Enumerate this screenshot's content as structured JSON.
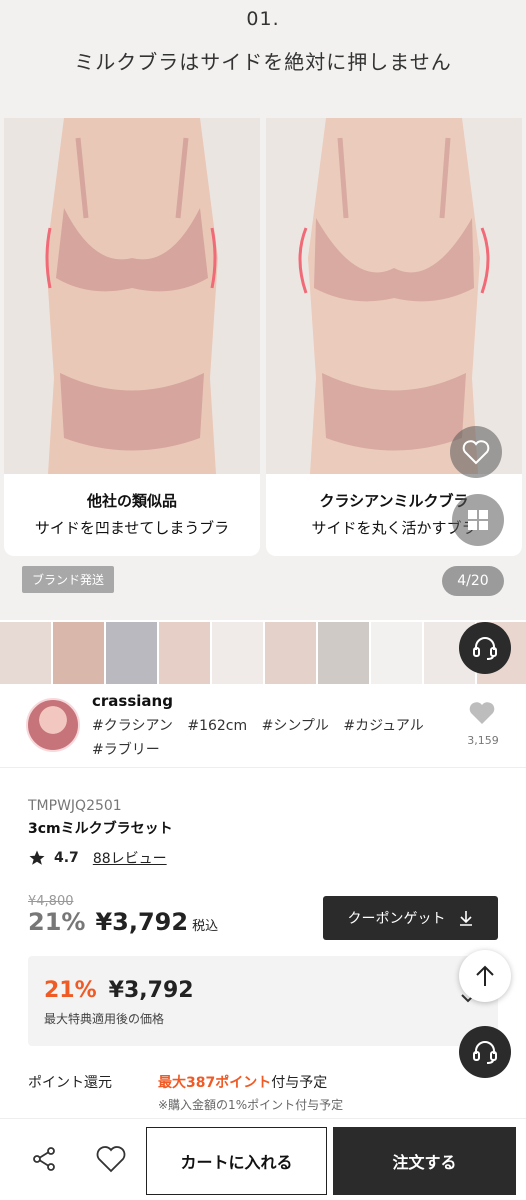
{
  "hero": {
    "number": "01.",
    "title": "ミルクブラはサイドを絶対に押しません",
    "left_caption": {
      "line1": "他社の類似品",
      "line2": "サイドを凹ませてしまうブラ"
    },
    "right_caption": {
      "line1": "クラシアンミルクブラ",
      "line2": "サイドを丸く活かすブラ"
    },
    "brand_badge": "ブランド発送",
    "counter": "4/20"
  },
  "seller": {
    "name": "crassiang",
    "tags": [
      "#クラシアン",
      "#162cm",
      "#シンプル",
      "#カジュアル",
      "#ラブリー"
    ],
    "like_count": "3,159"
  },
  "product": {
    "code": "TMPWJQ2501",
    "name": "3cmミルクブラセット",
    "rating": "4.7",
    "reviews": "88レビュー",
    "original_price": "¥4,800",
    "discount": "21%",
    "price": "¥3,792",
    "tax_label": "税込",
    "coupon_button": "クーポンゲット",
    "best_discount": "21%",
    "best_price": "¥3,792",
    "best_note": "最大特典適用後の価格",
    "points_label": "ポイント還元",
    "points_highlight": "最大387ポイント",
    "points_suffix": "付与予定",
    "points_note": "※購入金額の1%ポイント付与予定"
  },
  "bottom_bar": {
    "cart_button": "カートに入れる",
    "order_button": "注文する"
  },
  "colors": {
    "accent_orange": "#f05a24",
    "dark": "#2b2b2b",
    "skin_pink": "#d9a7a0"
  }
}
